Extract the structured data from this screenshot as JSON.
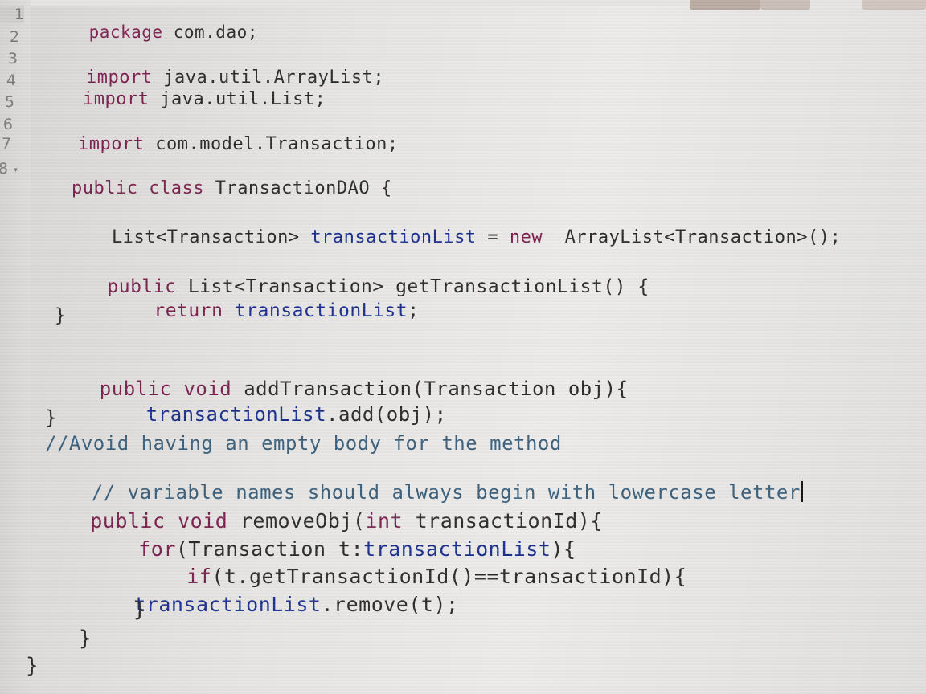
{
  "editor": {
    "line_numbers": [
      "1",
      "2",
      "3",
      "4",
      "5",
      "6",
      "7",
      "8"
    ],
    "lines": {
      "l1": {
        "kw": "package",
        "rest": " com.dao;"
      },
      "l3": {
        "kw": "import",
        "rest": " java.util.ArrayList;"
      },
      "l4": {
        "kw": "import",
        "rest": " java.util.List;"
      },
      "l6": {
        "kw": "import",
        "rest": " com.model.Transaction;"
      },
      "l8": {
        "kw1": "public",
        "kw2": "class",
        "rest": " TransactionDAO {"
      },
      "field_decl": {
        "type": "List<Transaction> ",
        "name": "transactionList",
        "eq": " = ",
        "kw": "new",
        "rest": "  ArrayList<Transaction>();"
      },
      "get_sig": {
        "kw": "public",
        "rest": " List<Transaction> getTransactionList() {"
      },
      "get_body": {
        "kw": "return",
        "sp": " ",
        "field": "transactionList",
        "end": ";"
      },
      "get_close": "}",
      "add_sig": {
        "kw1": "public",
        "kw2": "void",
        "rest": " addTransaction(Transaction obj){"
      },
      "add_body": {
        "field": "transactionList",
        "rest": ".add(obj);"
      },
      "add_close": "}",
      "comment1": "//Avoid having an empty body for the method",
      "comment2": "// variable names should always begin with lowercase letter",
      "remove_sig": {
        "kw1": "public",
        "kw2": "void",
        "rest1": " removeObj(",
        "kw3": "int",
        "rest2": " transactionId){"
      },
      "for_line": {
        "kw": "for",
        "rest1": "(Transaction t:",
        "field": "transactionList",
        "rest2": "){"
      },
      "if_line": {
        "kw": "if",
        "rest": "(t.getTransactionId()==transactionId){"
      },
      "remove_call": {
        "field": "transactionList",
        "rest": ".remove(t);"
      },
      "close_if": "}",
      "close_for": "}",
      "close_class": "}"
    }
  }
}
